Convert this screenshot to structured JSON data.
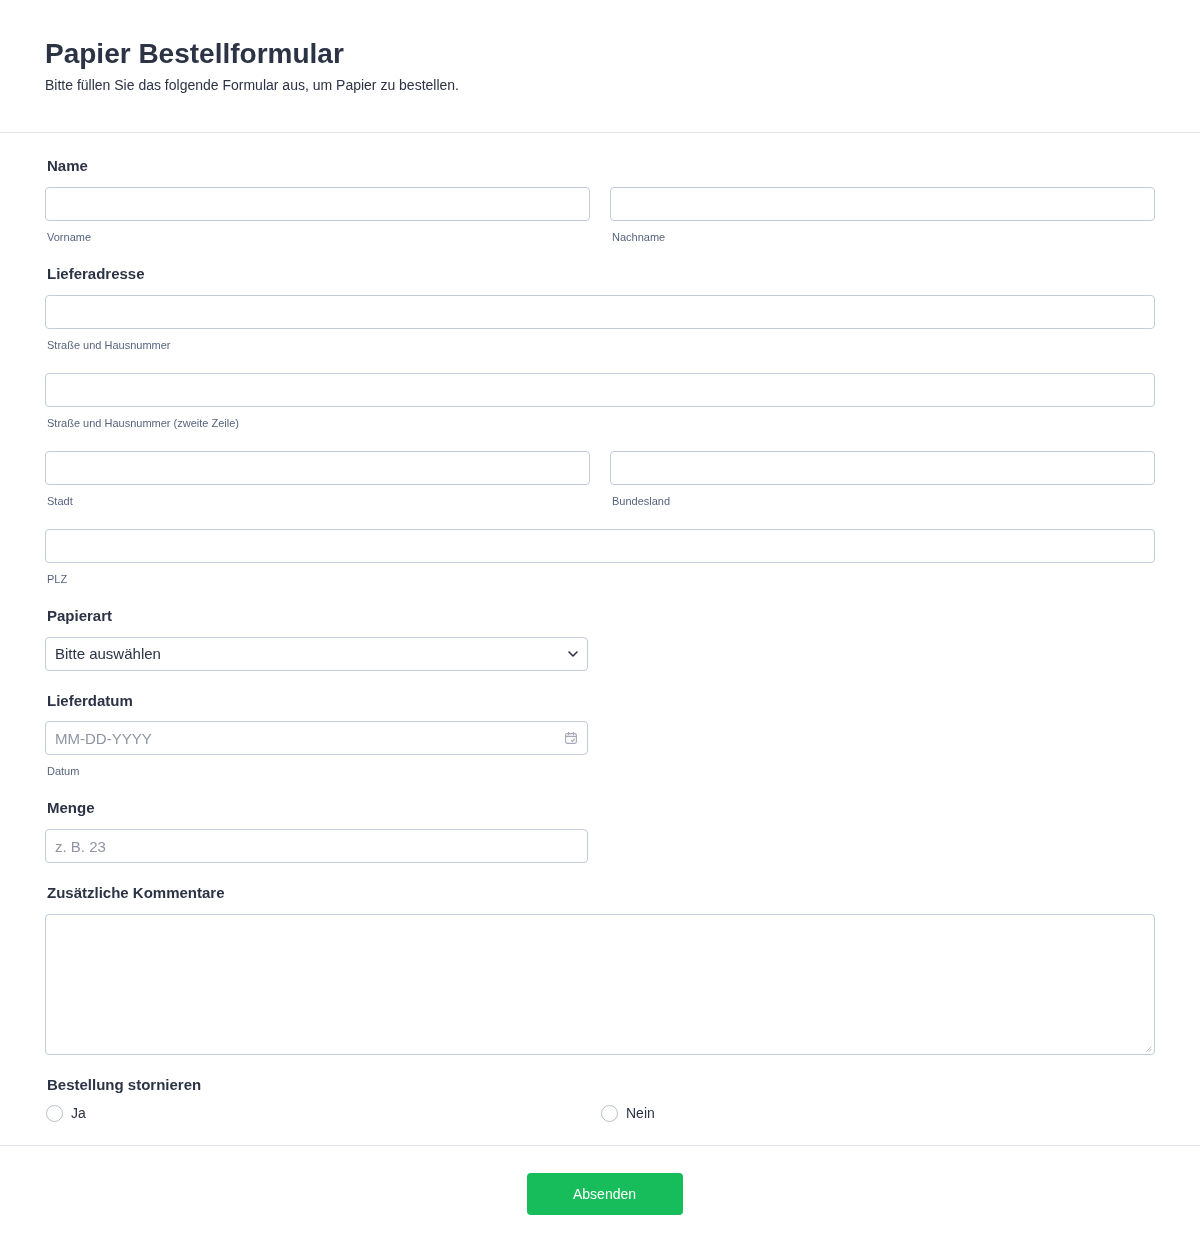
{
  "form": {
    "title": "Papier Bestellformular",
    "description": "Bitte füllen Sie das folgende Formular aus, um Papier zu bestellen."
  },
  "fields": [
    {
      "kind": "inputs",
      "label": "Name",
      "rows": [
        [
          {
            "sublabel": "Vorname"
          },
          {
            "sublabel": "Nachname"
          }
        ]
      ]
    },
    {
      "kind": "inputs",
      "label": "Lieferadresse",
      "rows": [
        [
          {
            "sublabel": "Straße und Hausnummer"
          }
        ],
        [
          {
            "sublabel": "Straße und Hausnummer (zweite Zeile)"
          }
        ],
        [
          {
            "sublabel": "Stadt"
          },
          {
            "sublabel": "Bundesland"
          }
        ],
        [
          {
            "sublabel": "PLZ"
          }
        ]
      ]
    },
    {
      "kind": "select",
      "label": "Papierart",
      "value": "Bitte auswählen"
    },
    {
      "kind": "date",
      "label": "Lieferdatum",
      "placeholder": "MM-DD-YYYY",
      "sublabel": "Datum"
    },
    {
      "kind": "number",
      "label": "Menge",
      "placeholder": "z. B. 23"
    },
    {
      "kind": "textarea",
      "label": "Zusätzliche Kommentare"
    },
    {
      "kind": "radio",
      "label": "Bestellung stornieren",
      "options": [
        {
          "label": "Ja",
          "selected": false
        },
        {
          "label": "Nein",
          "selected": false
        }
      ]
    }
  ],
  "submit": {
    "label": "Absenden"
  }
}
